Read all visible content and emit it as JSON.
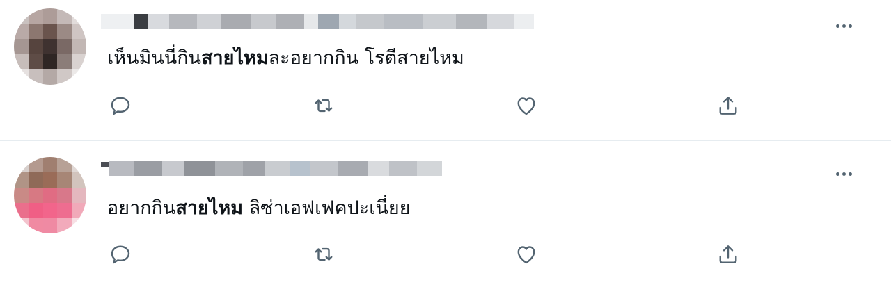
{
  "tweets": [
    {
      "author_blurred": true,
      "text_parts": [
        {
          "text": "เห็นมินนี่กิน",
          "bold": false
        },
        {
          "text": "สายไหม",
          "bold": true
        },
        {
          "text": "ละอยากกิน โรตีสายไหม",
          "bold": false
        }
      ]
    },
    {
      "author_blurred": true,
      "text_parts": [
        {
          "text": "อยากกิน",
          "bold": false
        },
        {
          "text": "สายไหม",
          "bold": true
        },
        {
          "text": " ลิซ่าเอฟเฟคปะเนี่ยย",
          "bold": false
        }
      ]
    }
  ],
  "actions": {
    "reply_icon": "reply-icon",
    "retweet_icon": "retweet-icon",
    "like_icon": "heart-icon",
    "share_icon": "share-icon",
    "more_icon": "more-icon",
    "icon_color": "#536471"
  }
}
